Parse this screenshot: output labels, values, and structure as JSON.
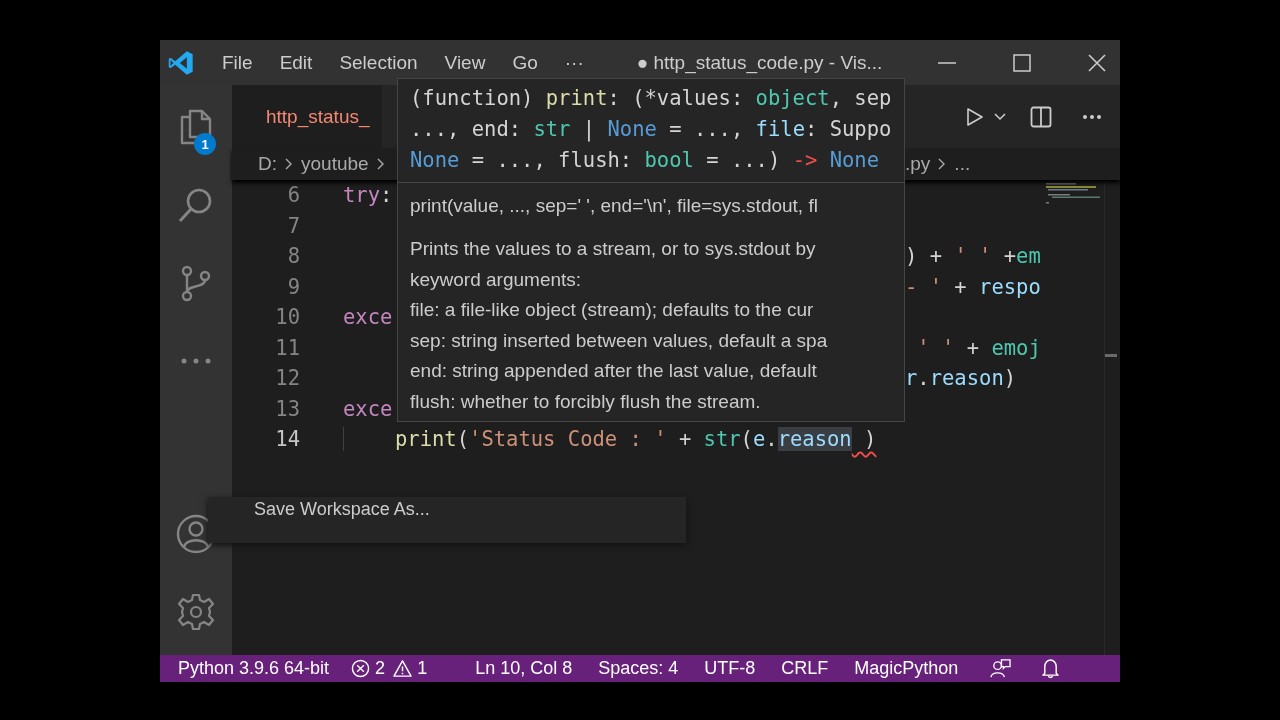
{
  "window": {
    "title": "● http_status_code.py - Vis...",
    "menu": [
      "File",
      "Edit",
      "Selection",
      "View",
      "Go",
      "···"
    ]
  },
  "activity_bar": {
    "explorer_badge": "1"
  },
  "tab": {
    "label": "http_status_",
    "has_errors": true
  },
  "breadcrumbs": {
    "left": [
      "D:",
      "youtube"
    ],
    "right": [
      ".py",
      "..."
    ]
  },
  "editor": {
    "lines": [
      {
        "number": "6",
        "current": false,
        "indented": false,
        "code": [
          {
            "text": "try",
            "kind": "keyword"
          },
          {
            "text": ":",
            "kind": "plain"
          }
        ]
      },
      {
        "number": "7",
        "current": false
      },
      {
        "number": "8",
        "current": false,
        "tail": [
          {
            "text": ") + ",
            "kind": "plain"
          },
          {
            "text": "' '",
            "kind": "string"
          },
          {
            "text": " +",
            "kind": "plain"
          },
          {
            "text": "em",
            "kind": "type"
          }
        ]
      },
      {
        "number": "9",
        "current": false,
        "tail": [
          {
            "text": "- '",
            "kind": "string"
          },
          {
            "text": " + ",
            "kind": "plain"
          },
          {
            "text": "respo",
            "kind": "variable"
          }
        ]
      },
      {
        "number": "10",
        "current": false,
        "indented": false,
        "code": [
          {
            "text": "exce",
            "kind": "keyword"
          }
        ]
      },
      {
        "number": "11",
        "current": false,
        "tail": [
          {
            "text": " ' '",
            "kind": "string"
          },
          {
            "text": " + ",
            "kind": "plain"
          },
          {
            "text": "emoj",
            "kind": "type"
          }
        ]
      },
      {
        "number": "12",
        "current": false,
        "tail": [
          {
            "text": "r",
            "kind": "variable"
          },
          {
            "text": ".",
            "kind": "plain"
          },
          {
            "text": "reason",
            "kind": "variable"
          },
          {
            "text": ")",
            "kind": "plain"
          }
        ]
      },
      {
        "number": "13",
        "current": false,
        "indented": false,
        "code": [
          {
            "text": "exce",
            "kind": "keyword"
          }
        ]
      },
      {
        "number": "14",
        "current": true,
        "indented": true,
        "code": [
          {
            "text": "print",
            "kind": "function"
          },
          {
            "text": "(",
            "kind": "plain"
          },
          {
            "text": "'Status Code : '",
            "kind": "string"
          },
          {
            "text": " + ",
            "kind": "plain"
          },
          {
            "text": "str",
            "kind": "type"
          },
          {
            "text": "(",
            "kind": "plain"
          },
          {
            "text": "e",
            "kind": "variable"
          },
          {
            "text": ".",
            "kind": "plain"
          },
          {
            "text": "reason",
            "kind": "variable",
            "highlight": true
          },
          {
            "text": " )",
            "kind": "plain",
            "error": true
          }
        ]
      }
    ]
  },
  "hover": {
    "signature": [
      [
        {
          "text": "(function) ",
          "kind": "plain"
        },
        {
          "text": "print",
          "kind": "function"
        },
        {
          "text": ": (*values: ",
          "kind": "plain"
        },
        {
          "text": "object",
          "kind": "type"
        },
        {
          "text": ", sep",
          "kind": "plain"
        }
      ],
      [
        {
          "text": "..., end: ",
          "kind": "plain"
        },
        {
          "text": "str",
          "kind": "type"
        },
        {
          "text": " | ",
          "kind": "plain"
        },
        {
          "text": "None",
          "kind": "constant"
        },
        {
          "text": " = ..., ",
          "kind": "plain"
        },
        {
          "text": "file",
          "kind": "variable"
        },
        {
          "text": ": Suppo",
          "kind": "plain"
        }
      ],
      [
        {
          "text": "None",
          "kind": "constant"
        },
        {
          "text": " = ..., flush: ",
          "kind": "plain"
        },
        {
          "text": "bool",
          "kind": "type"
        },
        {
          "text": " = ...) ",
          "kind": "plain"
        },
        {
          "text": "->",
          "kind": "operator"
        },
        {
          "text": " None",
          "kind": "constant"
        }
      ]
    ],
    "usage": "print(value, ..., sep=' ', end='\\n', file=sys.stdout, fl",
    "doc": [
      "Prints the values to a stream, or to sys.stdout by",
      "keyword arguments:",
      "file: a file-like object (stream); defaults to the cur",
      "sep: string inserted between values, default a spa",
      "end: string appended after the last value, default",
      "flush: whether to forcibly flush the stream."
    ]
  },
  "context_menu": {
    "items": [
      "Save Workspace As..."
    ]
  },
  "status_bar": {
    "interpreter": "Python 3.9.6 64-bit",
    "errors": "2",
    "warnings": "1",
    "items": [
      "Ln 10, Col 8",
      "Spaces: 4",
      "UTF-8",
      "CRLF",
      "MagicPython"
    ]
  }
}
